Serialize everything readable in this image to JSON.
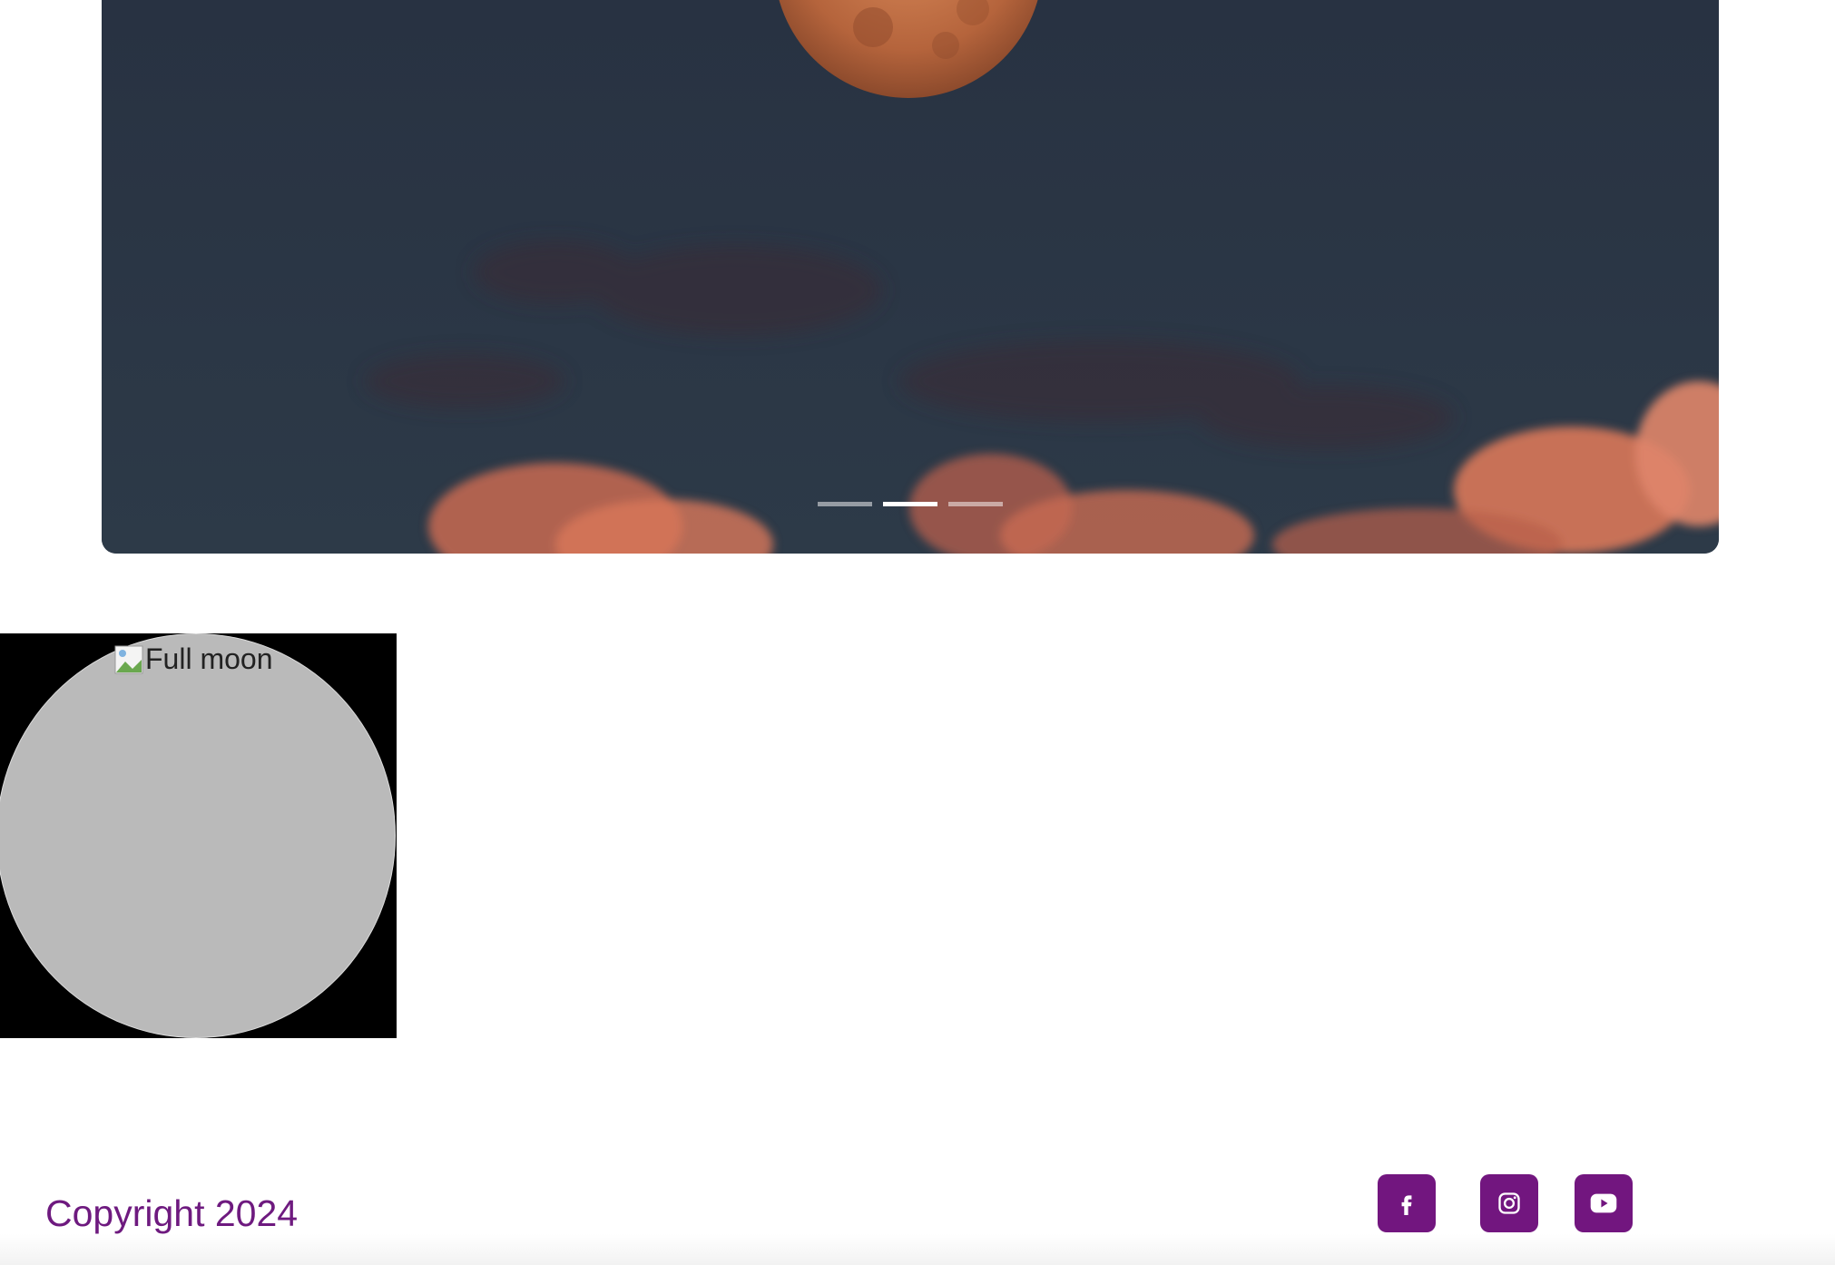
{
  "carousel": {
    "image_alt": "Full moon over clouds",
    "indicators": [
      {
        "label": "Slide 1",
        "active": false
      },
      {
        "label": "Slide 2",
        "active": true
      },
      {
        "label": "Slide 3",
        "active": false
      }
    ]
  },
  "moon_image": {
    "alt": "Full moon"
  },
  "footer": {
    "copyright": "Copyright 2024",
    "socials": [
      {
        "name": "facebook-icon"
      },
      {
        "name": "instagram-icon"
      },
      {
        "name": "youtube-icon"
      }
    ]
  },
  "colors": {
    "brand": "#72167f",
    "sky": "#2b3646",
    "clouds": "#d9785a",
    "moon": "#c7744a"
  }
}
